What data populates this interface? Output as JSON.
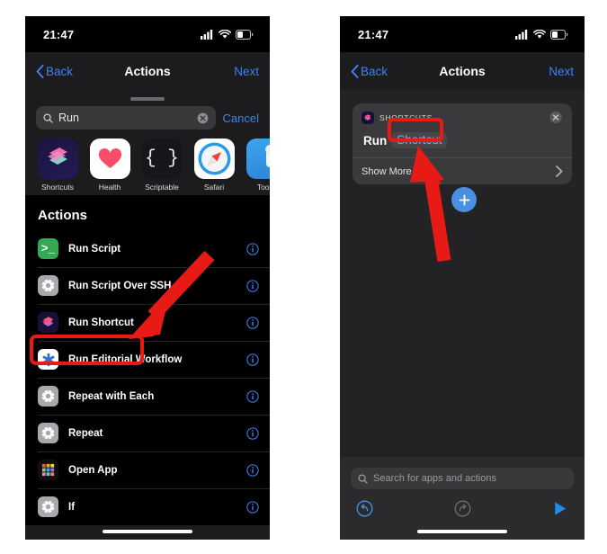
{
  "status_bar": {
    "time": "21:47",
    "icons": [
      "cellular-signal-icon",
      "wifi-icon",
      "battery-icon"
    ]
  },
  "nav_bar": {
    "back_label": "Back",
    "title": "Actions",
    "next_label": "Next"
  },
  "left_phone": {
    "search": {
      "value": "Run",
      "icon": "search-icon",
      "clear_icon": "clear-icon",
      "cancel_label": "Cancel"
    },
    "app_suggestions": [
      {
        "name": "Shortcuts",
        "icon": "shortcuts-app-icon"
      },
      {
        "name": "Health",
        "icon": "health-app-icon"
      },
      {
        "name": "Scriptable",
        "icon": "scriptable-app-icon"
      },
      {
        "name": "Safari",
        "icon": "safari-app-icon"
      },
      {
        "name": "Toolb",
        "icon": "toolbox-app-icon"
      }
    ],
    "section_title": "Actions",
    "actions": [
      {
        "label": "Run Script",
        "icon": "run-script-icon",
        "info": "info-icon"
      },
      {
        "label": "Run Script Over SSH",
        "icon": "gear-icon",
        "info": "info-icon"
      },
      {
        "label": "Run Shortcut",
        "icon": "shortcuts-icon",
        "info": "info-icon"
      },
      {
        "label": "Run Editorial Workflow",
        "icon": "editorial-icon",
        "info": "info-icon"
      },
      {
        "label": "Repeat with Each",
        "icon": "gear-icon",
        "info": "info-icon"
      },
      {
        "label": "Repeat",
        "icon": "gear-icon",
        "info": "info-icon"
      },
      {
        "label": "Open App",
        "icon": "app-grid-icon",
        "info": "info-icon"
      },
      {
        "label": "If",
        "icon": "gear-icon",
        "info": "info-icon"
      }
    ]
  },
  "right_phone": {
    "action_card": {
      "app_label": "SHORTCUTS",
      "app_icon": "shortcuts-icon",
      "close_icon": "close-icon",
      "verb": "Run",
      "token": "Shortcut",
      "show_more_label": "Show More",
      "chevron_icon": "chevron-right-icon"
    },
    "add_button": {
      "icon": "plus-icon"
    },
    "bottom": {
      "search_placeholder": "Search for apps and actions",
      "search_icon": "search-icon",
      "undo_icon": "undo-icon",
      "redo_icon": "redo-icon",
      "play_icon": "play-icon"
    }
  },
  "annotations": {
    "highlight_run_shortcut": "red-rectangle-run-shortcut",
    "highlight_token": "red-rectangle-shortcut-token",
    "arrow_left": "red-arrow-pointing-to-run-shortcut",
    "arrow_right": "red-arrow-pointing-to-shortcut-token"
  },
  "colors": {
    "accent_blue": "#3c82f6",
    "annotation_red": "#e81a16",
    "card_bg": "#3a3a3c",
    "canvas_bg": "#232325"
  }
}
